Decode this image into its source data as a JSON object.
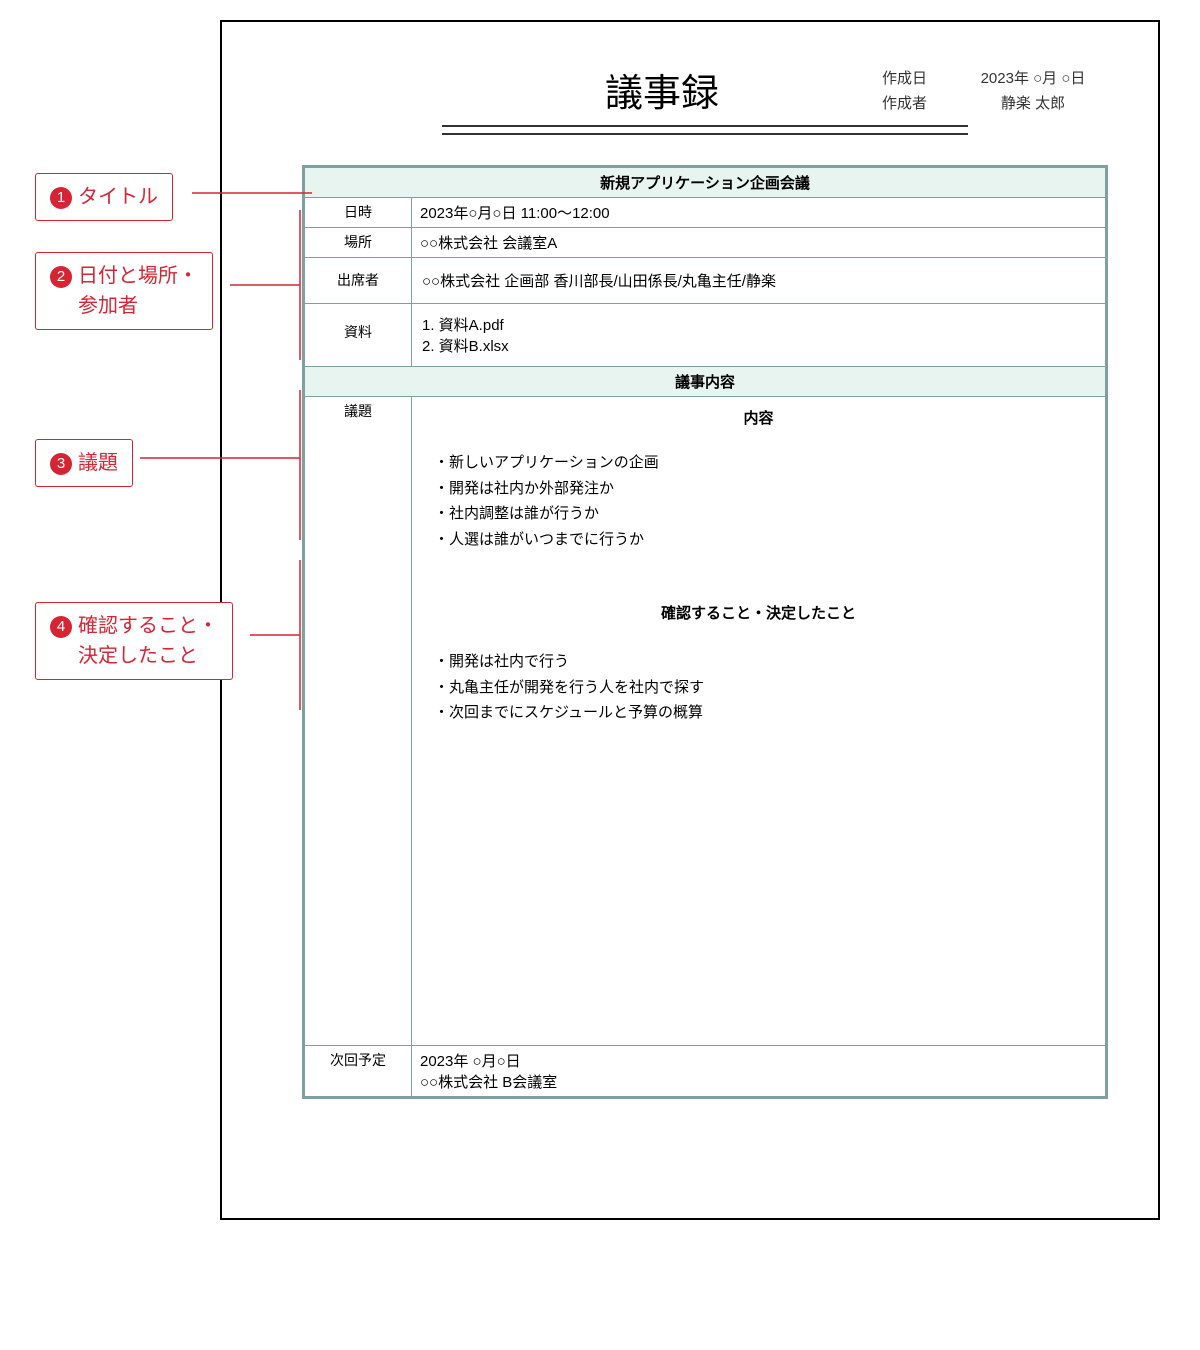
{
  "doc_title": "議事録",
  "meta": {
    "date_label": "作成日",
    "date_value": "2023年 ○月 ○日",
    "author_label": "作成者",
    "author_value": "静楽 太郎"
  },
  "sections": {
    "meeting_title": "新規アプリケーション企画会議",
    "rows": {
      "datetime_label": "日時",
      "datetime_value": "2023年○月○日 11:00～12:00",
      "place_label": "場所",
      "place_value": "○○株式会社 会議室A",
      "attendees_label": "出席者",
      "attendees_value": "○○株式会社 企画部 香川部長/山田係長/丸亀主任/静楽",
      "materials_label": "資料",
      "materials_value": "1. 資料A.pdf\n2. 資料B.xlsx"
    },
    "body_header": "議事内容",
    "agenda_label": "議題",
    "content_label": "内容",
    "agenda_items": [
      "・新しいアプリケーションの企画",
      "・開発は社内か外部発注か",
      "・社内調整は誰が行うか",
      "・人選は誰がいつまでに行うか"
    ],
    "confirm_header": "確認すること・決定したこと",
    "confirm_items": [
      "・開発は社内で行う",
      "・丸亀主任が開発を行う人を社内で探す",
      "・次回までにスケジュールと予算の概算"
    ],
    "next_label": "次回予定",
    "next_value": "2023年 ○月○日\n○○株式会社 B会議室"
  },
  "annotations": {
    "a1": {
      "num": "1",
      "text": "タイトル"
    },
    "a2": {
      "num": "2",
      "text_line1": "日付と場所・",
      "text_line2": "参加者"
    },
    "a3": {
      "num": "3",
      "text": "議題"
    },
    "a4": {
      "num": "4",
      "text_line1": "確認すること・",
      "text_line2": "決定したこと"
    }
  }
}
